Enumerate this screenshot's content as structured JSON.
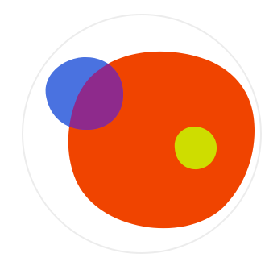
{
  "logo": {
    "name": "abstract-blob-logo",
    "colors": {
      "ring": "#ececec",
      "disc": "#ffffff",
      "red_blob": "#f04400",
      "blue_blob": "#4a72e0",
      "overlap": "#8e2a8c",
      "yellow_dot": "#cedd00"
    }
  }
}
